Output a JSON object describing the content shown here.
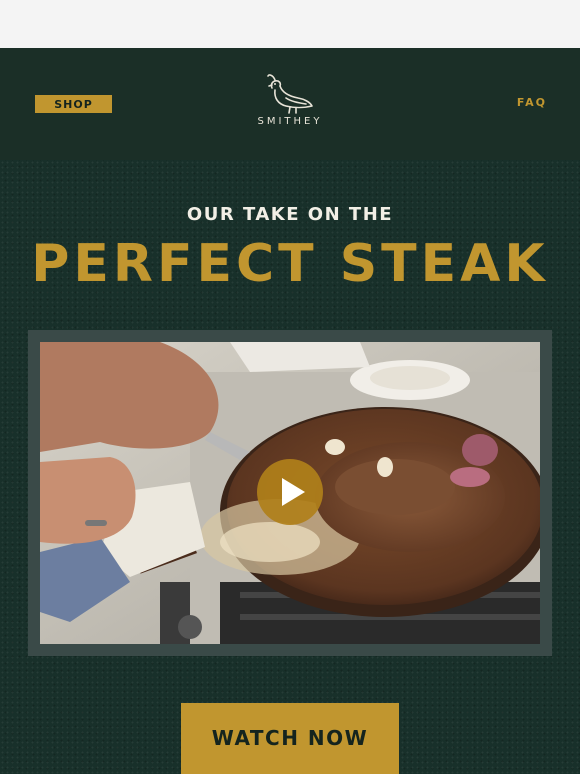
{
  "header": {
    "shop_label": "SHOP",
    "faq_label": "FAQ",
    "logo_text": "SMITHEY",
    "logo_icon": "quail-icon"
  },
  "hero": {
    "subtitle": "OUR TAKE ON THE",
    "title": "PERFECT STEAK",
    "video_icon": "play-icon",
    "cta_label": "WATCH NOW"
  },
  "colors": {
    "header_bg": "#1b2f27",
    "hero_bg": "#18302a",
    "accent_gold": "#c1962f",
    "text_light": "#f2efe6",
    "video_frame": "#3a4a48"
  }
}
